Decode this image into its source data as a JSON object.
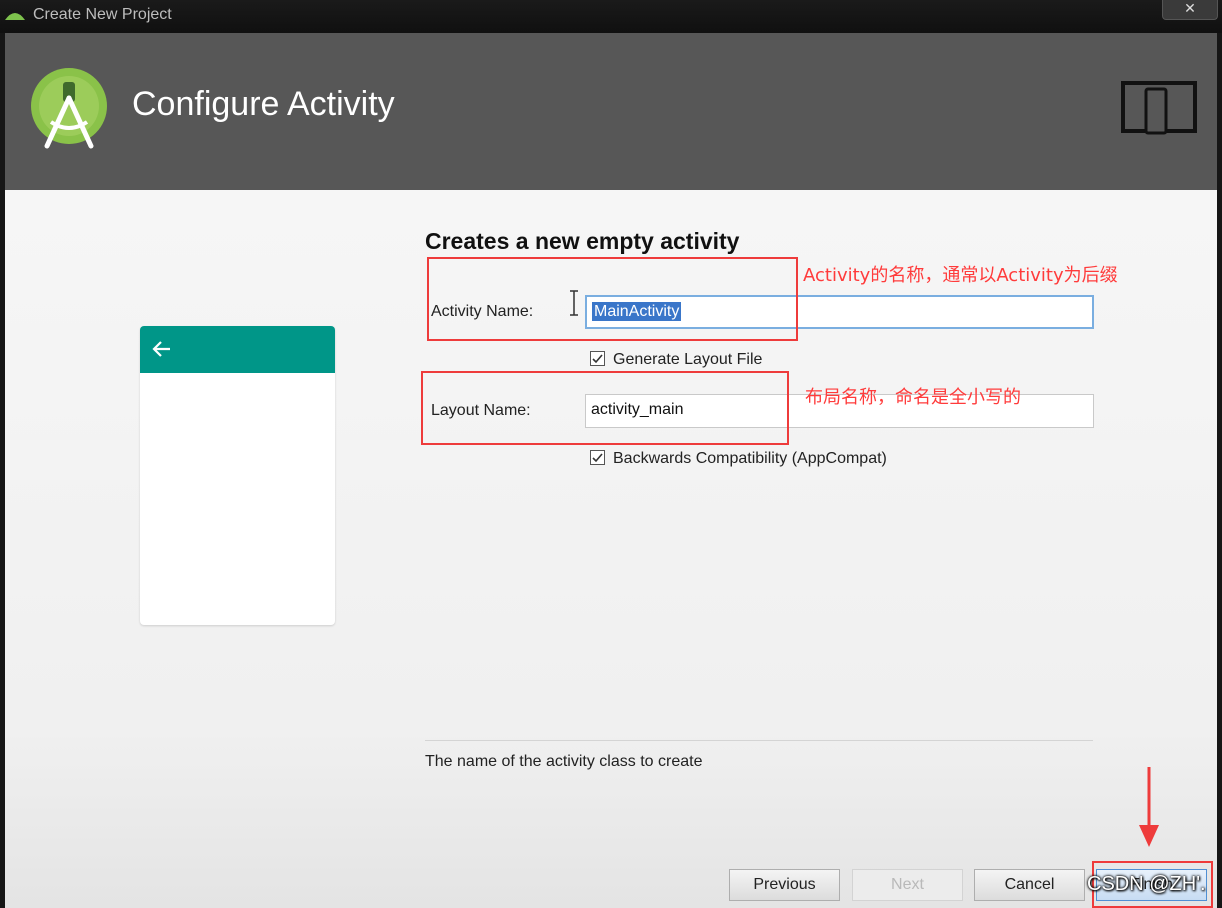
{
  "window": {
    "title": "Create New Project",
    "close_glyph": "✕"
  },
  "header": {
    "title": "Configure Activity",
    "logo_icon": "android-studio-icon",
    "device_icon": "phone-tablet-icon"
  },
  "preview": {
    "toolbar_color": "#009688",
    "back_icon": "arrow-left-icon"
  },
  "form": {
    "heading": "Creates a new empty activity",
    "activity_name": {
      "label": "Activity Name:",
      "value": "MainActivity"
    },
    "generate_layout": {
      "label": "Generate Layout File",
      "checked": true
    },
    "layout_name": {
      "label": "Layout Name:",
      "value": "activity_main"
    },
    "backwards_compat": {
      "label": "Backwards Compatibility (AppCompat)",
      "checked": true
    }
  },
  "annotations": {
    "activity_note": "Activity的名称，通常以Activity为后缀",
    "layout_note": "布局名称，命名是全小写的",
    "color": "#ee3b3b"
  },
  "hint": "The name of the activity class to create",
  "buttons": {
    "previous": "Previous",
    "next": "Next",
    "cancel": "Cancel",
    "finish": "Finish"
  },
  "watermark": "CSDN @ZH'."
}
